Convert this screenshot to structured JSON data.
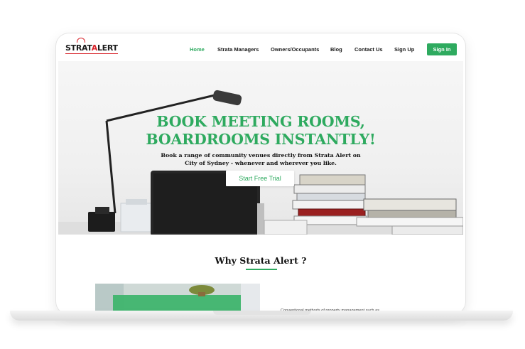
{
  "brand": {
    "logo_prefix": "STRAT",
    "logo_red": "A",
    "logo_suffix": "LERT"
  },
  "nav": {
    "items": [
      {
        "label": "Home",
        "active": true
      },
      {
        "label": "Strata Managers"
      },
      {
        "label": "Owners/Occupants"
      },
      {
        "label": "Blog"
      },
      {
        "label": "Contact Us"
      },
      {
        "label": "Sign Up"
      }
    ],
    "signin_label": "Sign In"
  },
  "hero": {
    "title_line1": "BOOK MEETING ROOMS,",
    "title_line2": "BOARDROOMS INSTANTLY!",
    "subtitle_line1": "Book a range of community venues directly from Strata Alert on",
    "subtitle_line2": "City of Sydney - whenever and wherever you like.",
    "cta_label": "Start Free Trial",
    "carousel": {
      "slides": 4,
      "active_index": 2
    }
  },
  "why": {
    "title": "Why Strata Alert ?",
    "text_snippet": "Conventional methods of property management such as"
  },
  "colors": {
    "accent": "#2eaa5f",
    "brand_red": "#d8232a"
  }
}
